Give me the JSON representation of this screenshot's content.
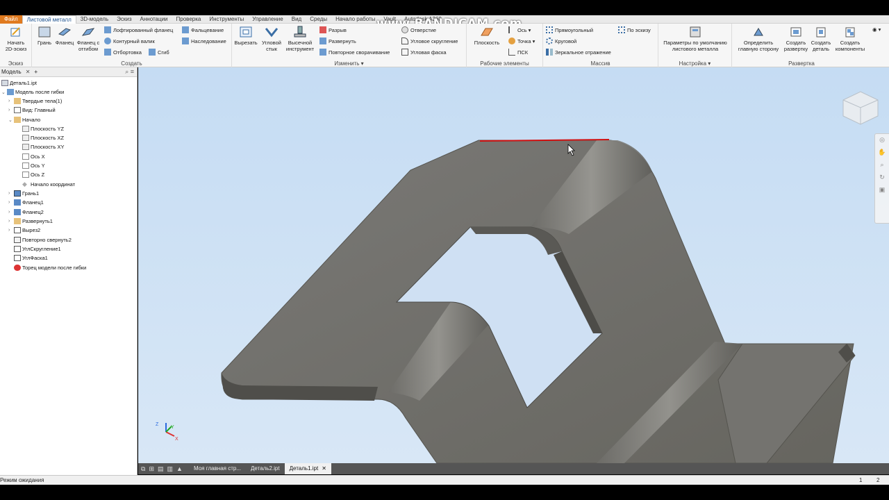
{
  "watermark": "www.BANDICAM.com",
  "tabs": [
    {
      "label": "Файл"
    },
    {
      "label": "Листовой металл"
    },
    {
      "label": "3D-модель"
    },
    {
      "label": "Эскиз"
    },
    {
      "label": "Аннотации"
    },
    {
      "label": "Проверка"
    },
    {
      "label": "Инструменты"
    },
    {
      "label": "Управление"
    },
    {
      "label": "Вид"
    },
    {
      "label": "Среды"
    },
    {
      "label": "Начало работы"
    },
    {
      "label": "Vault"
    },
    {
      "label": "Autodesk A360"
    }
  ],
  "ribbon": {
    "sketch": {
      "title": "Эскиз",
      "start": "Начать 2D-эскиз"
    },
    "create": {
      "title": "Создать",
      "face": "Грань",
      "flange": "Фланец",
      "flange_bend": "Фланец с отгибом",
      "lofted_flange": "Лофтированный фланец",
      "contour_roll": "Контурный валик",
      "hem": "Отбортовка",
      "fold": "Фальцевание",
      "inheritance": "Наследование",
      "bend": "Сгиб"
    },
    "modify": {
      "title": "Изменить",
      "cut": "Вырезать",
      "corner_seam": "Угловой стык",
      "punch": "Высечной инструмент",
      "rip": "Разрыв",
      "unfold": "Развернуть",
      "refold": "Повторное сворачивание",
      "hole": "Отверстие",
      "corner_round": "Угловое скругление",
      "corner_chamfer": "Угловая фаска"
    },
    "work": {
      "title": "Рабочие элементы",
      "plane": "Плоскость",
      "axis": "Ось",
      "point": "Точка",
      "ucs": "ПСК"
    },
    "pattern": {
      "title": "Массив",
      "rect": "Прямоугольный",
      "circular": "Круговой",
      "mirror": "Зеркальное отражение",
      "by_sketch": "По эскизу"
    },
    "setup": {
      "title": "Настройка",
      "defaults": "Параметры по умолчанию листового металла"
    },
    "flat": {
      "title": "Развертка",
      "define_side": "Определить главную сторону",
      "create_flat": "Создать развертку",
      "create_part": "Создать деталь",
      "create_comp": "Создать компоненты"
    }
  },
  "browser": {
    "tab": "Модель",
    "items": [
      {
        "label": "Деталь1.ipt"
      },
      {
        "label": "Модель после гибки"
      },
      {
        "label": "Твердые тела(1)"
      },
      {
        "label": "Вид: Главный"
      },
      {
        "label": "Начало"
      },
      {
        "label": "Плоскость YZ"
      },
      {
        "label": "Плоскость XZ"
      },
      {
        "label": "Плоскость XY"
      },
      {
        "label": "Ось X"
      },
      {
        "label": "Ось Y"
      },
      {
        "label": "Ось Z"
      },
      {
        "label": "Начало координат"
      },
      {
        "label": "Грань1"
      },
      {
        "label": "Фланец1"
      },
      {
        "label": "Фланец2"
      },
      {
        "label": "Развернуть1"
      },
      {
        "label": "Вырез2"
      },
      {
        "label": "Повторно свернуть2"
      },
      {
        "label": "УглСкругление1"
      },
      {
        "label": "УглФаска1"
      },
      {
        "label": "Торец модели после гибки"
      }
    ]
  },
  "doc_tabs": [
    {
      "label": "Моя главная стр..."
    },
    {
      "label": "Деталь2.ipt"
    },
    {
      "label": "Деталь1.ipt"
    }
  ],
  "status": {
    "text": "Режим ожидания",
    "n1": "1",
    "n2": "2"
  },
  "triad": {
    "x": "X",
    "y": "Y",
    "z": "Z"
  },
  "colors": {
    "file_tab": "#e07a1f",
    "viewport_top": "#c5dcf3",
    "part": "#6f6e6b",
    "edge_highlight": "#d01010"
  }
}
